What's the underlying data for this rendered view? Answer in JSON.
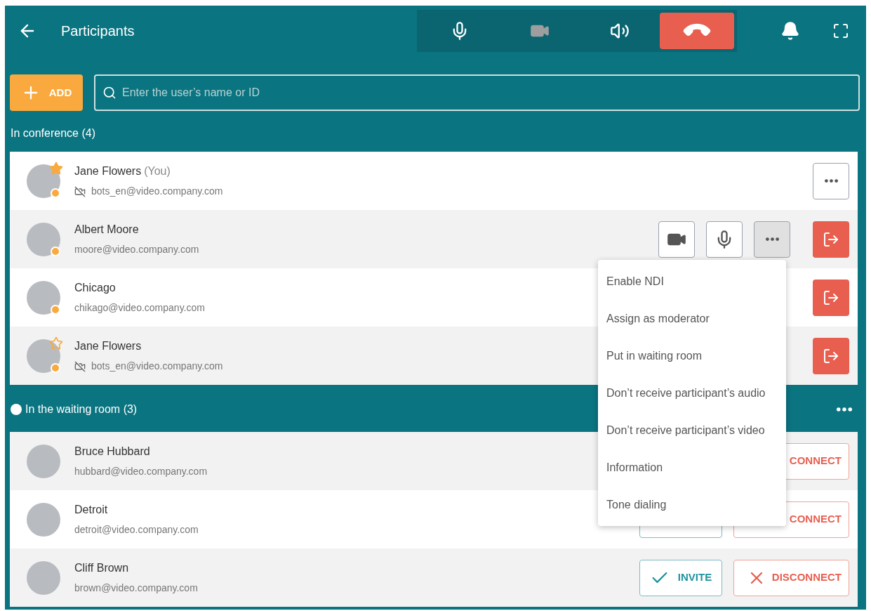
{
  "header": {
    "title": "Participants"
  },
  "call_controls": [
    {
      "kind": "mic",
      "on": true
    },
    {
      "kind": "camera",
      "on": false
    },
    {
      "kind": "speaker",
      "on": true
    },
    {
      "kind": "hangup",
      "on": true
    }
  ],
  "add_button": {
    "label": "ADD"
  },
  "search": {
    "placeholder": "Enter the user’s name or ID"
  },
  "conference": {
    "title": "In conference (4)",
    "participants": [
      {
        "name": "Jane Flowers",
        "suffix": "(You)",
        "email": "bots_en@video.company.com",
        "video_off": true,
        "starred": true,
        "star_filled": true,
        "actions": [
          {
            "kind": "more",
            "selected": false
          }
        ]
      },
      {
        "name": "Albert Moore",
        "email": "moore@video.company.com",
        "video_off": false,
        "starred": false,
        "actions": [
          {
            "kind": "video",
            "selected": false
          },
          {
            "kind": "mic",
            "selected": false
          },
          {
            "kind": "more",
            "selected": true
          },
          {
            "kind": "leave",
            "selected": false
          }
        ]
      },
      {
        "name": "Chicago",
        "email": "chikago@video.company.com",
        "video_off": false,
        "starred": false,
        "actions": [
          {
            "kind": "leave",
            "selected": false
          }
        ]
      },
      {
        "name": "Jane Flowers",
        "email": "bots_en@video.company.com",
        "video_off": true,
        "starred": true,
        "star_filled": false,
        "actions": [
          {
            "kind": "leave",
            "selected": false
          }
        ]
      }
    ]
  },
  "waiting": {
    "title": "In the waiting room (3)",
    "participants": [
      {
        "name": "Bruce Hubbard",
        "email": "hubbard@video.company.com",
        "invite_button": false,
        "disconnect_icon": false,
        "disconnect_label": "CONNECT"
      },
      {
        "name": "Detroit",
        "email": "detroit@video.company.com",
        "invite_button": true,
        "disconnect_icon": false,
        "disconnect_label": "CONNECT"
      },
      {
        "name": "Cliff Brown",
        "email": "brown@video.company.com",
        "invite_button": true,
        "invite_label": "INVITE",
        "disconnect_icon": true,
        "disconnect_label": "DISCONNECT"
      }
    ]
  },
  "menu": {
    "items": [
      "Enable NDI",
      "Assign as moderator",
      "Put in waiting room",
      "Don’t receive participant’s audio",
      "Don’t receive participant’s video",
      "Information",
      "Tone dialing"
    ]
  }
}
